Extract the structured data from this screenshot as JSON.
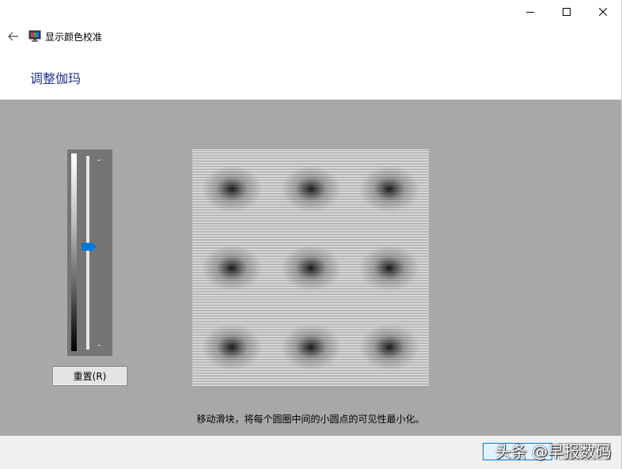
{
  "window": {
    "title": "显示颜色校准",
    "caption_buttons": [
      "minimize-icon",
      "maximize-icon",
      "close-icon"
    ]
  },
  "header": {
    "back_icon": "arrow-left-icon",
    "app_icon": "display-color-calibration-icon",
    "title": "显示颜色校准"
  },
  "page": {
    "title": "调整伽玛"
  },
  "gamma_slider": {
    "level": 0.53,
    "reset_label": "重置(R)"
  },
  "pattern": {
    "rows": 3,
    "cols": 3
  },
  "instruction": "移动滑块，将每个圆圈中间的小圆点的可见性最小化。",
  "footer": {
    "watermark": "头条 @早报数码"
  },
  "colors": {
    "title_blue": "#1e3287",
    "panel_gray": "#a8a8a8",
    "slider_bg": "#757575",
    "thumb_blue": "#0078d7",
    "footer_bg": "#f0f0f0"
  }
}
